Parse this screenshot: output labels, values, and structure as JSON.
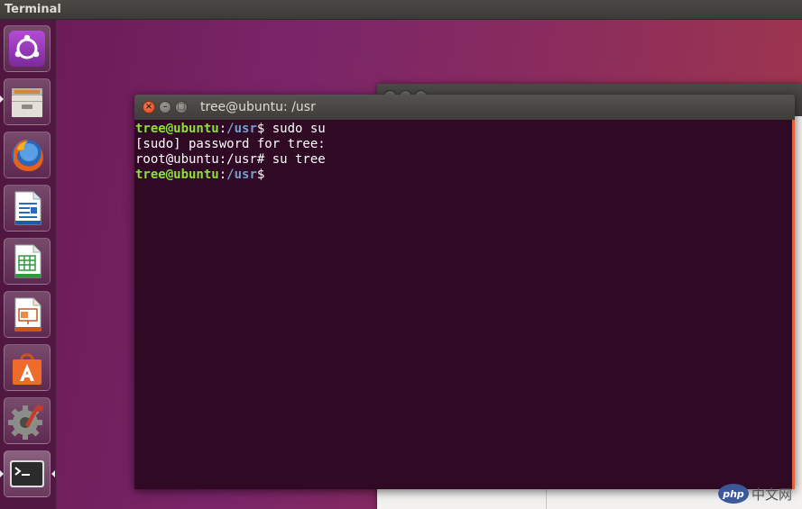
{
  "top_panel": {
    "title": "Terminal"
  },
  "launcher": {
    "items": [
      {
        "name": "dash-home-icon"
      },
      {
        "name": "files-icon"
      },
      {
        "name": "firefox-icon"
      },
      {
        "name": "libreoffice-writer-icon"
      },
      {
        "name": "libreoffice-calc-icon"
      },
      {
        "name": "libreoffice-impress-icon"
      },
      {
        "name": "software-center-icon"
      },
      {
        "name": "system-settings-icon"
      },
      {
        "name": "terminal-icon"
      }
    ]
  },
  "terminal": {
    "title": "tree@ubuntu: /usr",
    "lines": {
      "l1": {
        "user": "tree@ubuntu",
        "sep": ":",
        "path": "/usr",
        "prompt": "$ ",
        "cmd": "sudo su"
      },
      "l2": {
        "text": "[sudo] password for tree:"
      },
      "l3": {
        "text": "root@ubuntu:/usr# su tree"
      },
      "l4": {
        "user": "tree@ubuntu",
        "sep": ":",
        "path": "/usr",
        "prompt": "$"
      }
    },
    "colors": {
      "background": "#300a24",
      "user": "#8ae234",
      "path": "#729fcf",
      "text": "#ffffff"
    }
  },
  "watermark": {
    "logo": "php",
    "text": "中文网"
  }
}
